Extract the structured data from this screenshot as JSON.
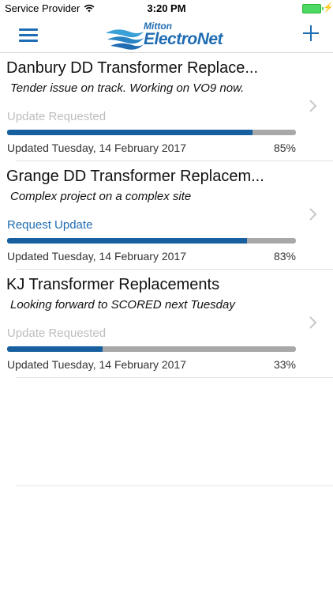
{
  "status_bar": {
    "carrier": "Service Provider",
    "time": "3:20 PM",
    "icons": [
      "wifi-icon",
      "battery-icon",
      "charging-bolt-icon"
    ]
  },
  "header": {
    "logo_top": "Mitton",
    "logo_main": "ElectroNet",
    "icons": [
      "hamburger-menu-icon",
      "add-icon"
    ],
    "accent_color": "#1e6db3"
  },
  "projects": [
    {
      "title": "Danbury DD Transformer Replace...",
      "note": "Tender issue on track. Working on VO9 now.",
      "action": "Update Requested",
      "action_state": "disabled",
      "progress": 0.85,
      "percent_label": "85%",
      "updated": "Updated Tuesday, 14 February 2017"
    },
    {
      "title": "Grange DD Transformer Replacem...",
      "note": "Complex project on a complex site",
      "action": "Request Update",
      "action_state": "active",
      "progress": 0.83,
      "percent_label": "83%",
      "updated": "Updated Tuesday, 14 February 2017"
    },
    {
      "title": "KJ Transformer Replacements",
      "note": "Looking forward to SCORED next Tuesday",
      "action": "Update Requested",
      "action_state": "disabled",
      "progress": 0.33,
      "percent_label": "33%",
      "updated": "Updated Tuesday, 14 February 2017"
    }
  ],
  "colors": {
    "progress_fill": "#17609f",
    "progress_track": "#a8a8a8",
    "disabled_text": "#bdbdbd",
    "link_text": "#1f6cb2"
  }
}
